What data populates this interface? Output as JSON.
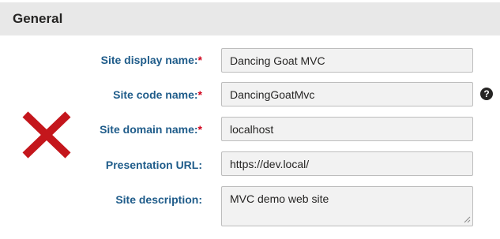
{
  "section": {
    "title": "General"
  },
  "status_icon": "close-icon",
  "colors": {
    "label": "#1f5c8a",
    "required": "#d0021b",
    "status_x": "#c4161c",
    "header_bg": "#e8e8e8"
  },
  "fields": {
    "site_display_name": {
      "label": "Site display name:",
      "required_mark": "*",
      "value": "Dancing Goat MVC"
    },
    "site_code_name": {
      "label": "Site code name:",
      "required_mark": "*",
      "value": "DancingGoatMvc",
      "help_icon": "question-circle-icon",
      "help_glyph": "?"
    },
    "site_domain_name": {
      "label": "Site domain name:",
      "required_mark": "*",
      "value": "localhost"
    },
    "presentation_url": {
      "label": "Presentation URL:",
      "value": "https://dev.local/"
    },
    "site_description": {
      "label": "Site description:",
      "value": "MVC demo web site"
    }
  }
}
